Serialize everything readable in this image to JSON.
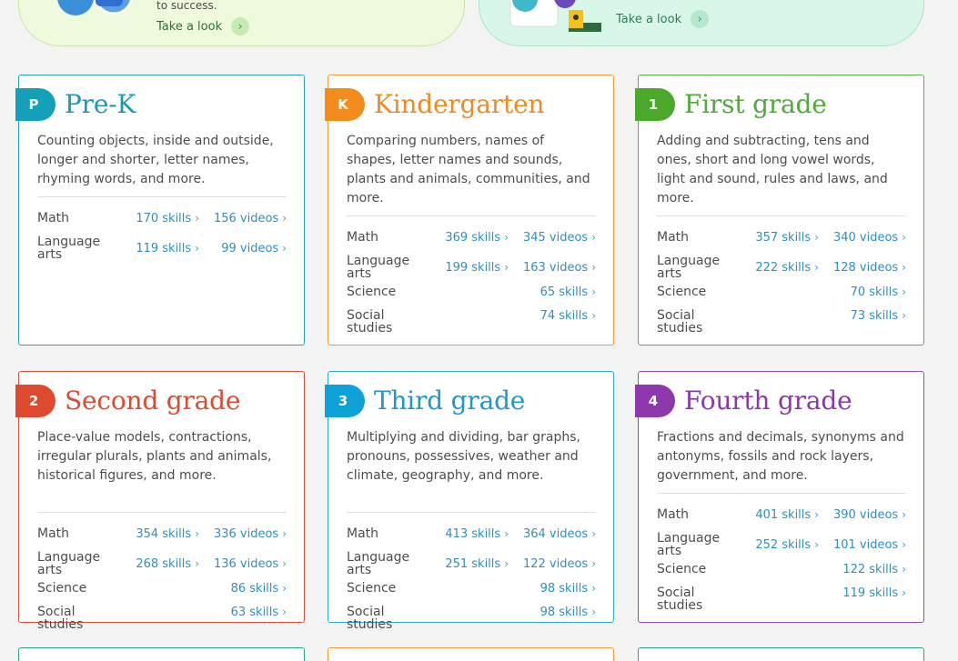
{
  "banners": [
    {
      "text": "to success.",
      "link": "Take a look"
    },
    {
      "link": "Take a look"
    }
  ],
  "cards": [
    {
      "badge": "P",
      "title": "Pre-K",
      "desc": "Counting objects, inside and outside, longer and shorter, letter names, rhyming words, and more.",
      "subjects": [
        {
          "name": "Math",
          "skills": "170 skills",
          "videos": "156 videos"
        },
        {
          "name": "Language arts",
          "skills": "119 skills",
          "videos": "99 videos"
        }
      ]
    },
    {
      "badge": "K",
      "title": "Kindergarten",
      "desc": "Comparing numbers, names of shapes, letter names and sounds, plants and animals, communities, and more.",
      "subjects": [
        {
          "name": "Math",
          "skills": "369 skills",
          "videos": "345 videos"
        },
        {
          "name": "Language arts",
          "skills": "199 skills",
          "videos": "163 videos"
        },
        {
          "name": "Science",
          "skills": "65 skills"
        },
        {
          "name": "Social studies",
          "skills": "74 skills"
        }
      ]
    },
    {
      "badge": "1",
      "title": "First grade",
      "desc": "Adding and subtracting, tens and ones, short and long vowel words, light and sound, rules and laws, and more.",
      "subjects": [
        {
          "name": "Math",
          "skills": "357 skills",
          "videos": "340 videos"
        },
        {
          "name": "Language arts",
          "skills": "222 skills",
          "videos": "128 videos"
        },
        {
          "name": "Science",
          "skills": "70 skills"
        },
        {
          "name": "Social studies",
          "skills": "73 skills"
        }
      ]
    },
    {
      "badge": "2",
      "title": "Second grade",
      "desc": "Place-value models, contractions, irregular plurals, plants and animals, historical figures, and more.",
      "subjects": [
        {
          "name": "Math",
          "skills": "354 skills",
          "videos": "336 videos"
        },
        {
          "name": "Language arts",
          "skills": "268 skills",
          "videos": "136 videos"
        },
        {
          "name": "Science",
          "skills": "86 skills"
        },
        {
          "name": "Social studies",
          "skills": "63 skills"
        }
      ]
    },
    {
      "badge": "3",
      "title": "Third grade",
      "desc": "Multiplying and dividing, bar graphs, pronouns, possessives, weather and climate, geography, and more.",
      "subjects": [
        {
          "name": "Math",
          "skills": "413 skills",
          "videos": "364 videos"
        },
        {
          "name": "Language arts",
          "skills": "251 skills",
          "videos": "122 videos"
        },
        {
          "name": "Science",
          "skills": "98 skills"
        },
        {
          "name": "Social studies",
          "skills": "98 skills"
        }
      ]
    },
    {
      "badge": "4",
      "title": "Fourth grade",
      "desc": "Fractions and decimals, synonyms and antonyms, fossils and rock layers, government, and more.",
      "subjects": [
        {
          "name": "Math",
          "skills": "401 skills",
          "videos": "390 videos"
        },
        {
          "name": "Language arts",
          "skills": "252 skills",
          "videos": "101 videos"
        },
        {
          "name": "Science",
          "skills": "122 skills"
        },
        {
          "name": "Social studies",
          "skills": "119 skills"
        }
      ]
    }
  ]
}
